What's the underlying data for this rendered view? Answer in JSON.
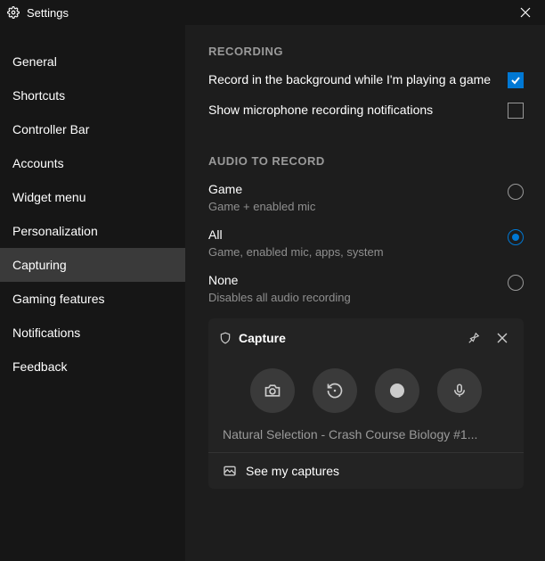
{
  "title": "Settings",
  "sidebar": {
    "items": [
      {
        "label": "General"
      },
      {
        "label": "Shortcuts"
      },
      {
        "label": "Controller Bar"
      },
      {
        "label": "Accounts"
      },
      {
        "label": "Widget menu"
      },
      {
        "label": "Personalization"
      },
      {
        "label": "Capturing",
        "active": true
      },
      {
        "label": "Gaming features"
      },
      {
        "label": "Notifications"
      },
      {
        "label": "Feedback"
      }
    ]
  },
  "recording": {
    "header": "RECORDING",
    "background": {
      "label": "Record in the background while I'm playing a game",
      "checked": true
    },
    "mic_notifications": {
      "label": "Show microphone recording notifications",
      "checked": false
    }
  },
  "audio": {
    "header": "AUDIO TO RECORD",
    "options": [
      {
        "title": "Game",
        "sub": "Game + enabled mic",
        "selected": false
      },
      {
        "title": "All",
        "sub": "Game, enabled mic, apps, system",
        "selected": true
      },
      {
        "title": "None",
        "sub": "Disables all audio recording",
        "selected": false
      }
    ]
  },
  "capture": {
    "title": "Capture",
    "caption": "Natural Selection - Crash Course Biology #1...",
    "see_all": "See my captures"
  }
}
